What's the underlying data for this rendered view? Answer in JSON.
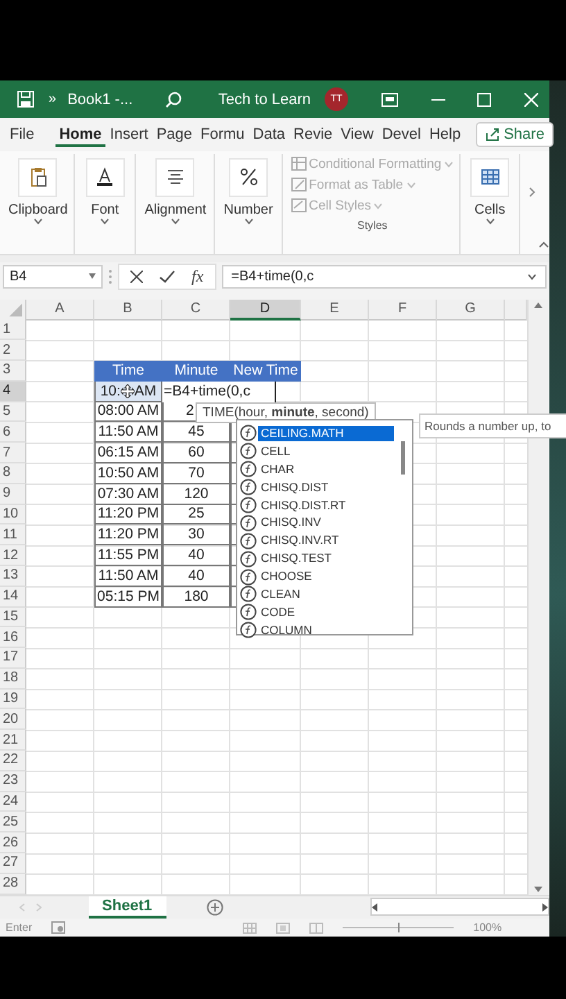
{
  "title_bar": {
    "overflow": "»",
    "title": "Book1 -...",
    "account": "Tech to Learn",
    "avatar": "TT"
  },
  "ribbon_tabs": [
    {
      "label": "File",
      "selected": false
    },
    {
      "label": "Home",
      "selected": true
    },
    {
      "label": "Insert",
      "selected": false
    },
    {
      "label": "Page",
      "selected": false
    },
    {
      "label": "Formu",
      "selected": false
    },
    {
      "label": "Data",
      "selected": false
    },
    {
      "label": "Revie",
      "selected": false
    },
    {
      "label": "View",
      "selected": false
    },
    {
      "label": "Devel",
      "selected": false
    },
    {
      "label": "Help",
      "selected": false
    }
  ],
  "share": "Share",
  "ribbon_groups": [
    {
      "kind": "button",
      "label": "Clipboard"
    },
    {
      "kind": "button",
      "label": "Font"
    },
    {
      "kind": "button",
      "label": "Alignment"
    },
    {
      "kind": "button",
      "label": "Number"
    },
    {
      "kind": "styles",
      "label": "Styles",
      "items": [
        {
          "label": "Conditional Formatting",
          "disabled": true
        },
        {
          "label": "Format as Table",
          "disabled": true
        },
        {
          "label": "Cell Styles",
          "disabled": true
        }
      ]
    },
    {
      "kind": "button",
      "label": "Cells"
    }
  ],
  "formula_bar": {
    "name_box": "B4",
    "fx": "fx",
    "formula": "=B4+time(0,c"
  },
  "columns": [
    {
      "label": "A",
      "selected": false
    },
    {
      "label": "B",
      "selected": false
    },
    {
      "label": "C",
      "selected": false
    },
    {
      "label": "D",
      "selected": true
    },
    {
      "label": "E",
      "selected": false
    },
    {
      "label": "F",
      "selected": false
    },
    {
      "label": "G",
      "selected": false
    }
  ],
  "row_headers": [
    {
      "label": "1",
      "selected": false
    },
    {
      "label": "2",
      "selected": false
    },
    {
      "label": "3",
      "selected": false
    },
    {
      "label": "4",
      "selected": true
    },
    {
      "label": "5",
      "selected": false
    },
    {
      "label": "6",
      "selected": false
    },
    {
      "label": "7",
      "selected": false
    },
    {
      "label": "8",
      "selected": false
    },
    {
      "label": "9",
      "selected": false
    },
    {
      "label": "10",
      "selected": false
    },
    {
      "label": "11",
      "selected": false
    },
    {
      "label": "12",
      "selected": false
    },
    {
      "label": "13",
      "selected": false
    },
    {
      "label": "14",
      "selected": false
    },
    {
      "label": "15",
      "selected": false
    },
    {
      "label": "16",
      "selected": false
    },
    {
      "label": "17",
      "selected": false
    },
    {
      "label": "18",
      "selected": false
    },
    {
      "label": "19",
      "selected": false
    },
    {
      "label": "20",
      "selected": false
    },
    {
      "label": "21",
      "selected": false
    },
    {
      "label": "22",
      "selected": false
    },
    {
      "label": "23",
      "selected": false
    },
    {
      "label": "24",
      "selected": false
    },
    {
      "label": "25",
      "selected": false
    },
    {
      "label": "26",
      "selected": false
    },
    {
      "label": "27",
      "selected": false
    },
    {
      "label": "28",
      "selected": false
    }
  ],
  "table": {
    "headers": [
      "Time",
      "Minute",
      "New Time"
    ],
    "editing_row": {
      "time_parts": [
        "10:",
        "AM"
      ],
      "entry": "=B4+time(0,c"
    },
    "rows": [
      [
        "08:00 AM",
        "2"
      ],
      [
        "11:50 AM",
        "45"
      ],
      [
        "06:15 AM",
        "60"
      ],
      [
        "10:50 AM",
        "70"
      ],
      [
        "07:30 AM",
        "120"
      ],
      [
        "11:20 PM",
        "25"
      ],
      [
        "11:20 PM",
        "30"
      ],
      [
        "11:55 PM",
        "40"
      ],
      [
        "11:50 AM",
        "40"
      ],
      [
        "05:15 PM",
        "180"
      ]
    ]
  },
  "function_tip": "TIME(hour, **minute**, second)",
  "autocomplete": {
    "items": [
      {
        "label": "CEILING.MATH",
        "selected": true
      },
      {
        "label": "CELL",
        "selected": false
      },
      {
        "label": "CHAR",
        "selected": false
      },
      {
        "label": "CHISQ.DIST",
        "selected": false
      },
      {
        "label": "CHISQ.DIST.RT",
        "selected": false
      },
      {
        "label": "CHISQ.INV",
        "selected": false
      },
      {
        "label": "CHISQ.INV.RT",
        "selected": false
      },
      {
        "label": "CHISQ.TEST",
        "selected": false
      },
      {
        "label": "CHOOSE",
        "selected": false
      },
      {
        "label": "CLEAN",
        "selected": false
      },
      {
        "label": "CODE",
        "selected": false
      },
      {
        "label": "COLUMN",
        "selected": false
      }
    ],
    "description": "Rounds a number up, to"
  },
  "sheet_tabs": [
    {
      "label": "Sheet1",
      "selected": true
    }
  ],
  "status_bar": {
    "mode": "Enter",
    "zoom": "100%",
    "zoom_slider": {
      "level": 0.5
    }
  }
}
